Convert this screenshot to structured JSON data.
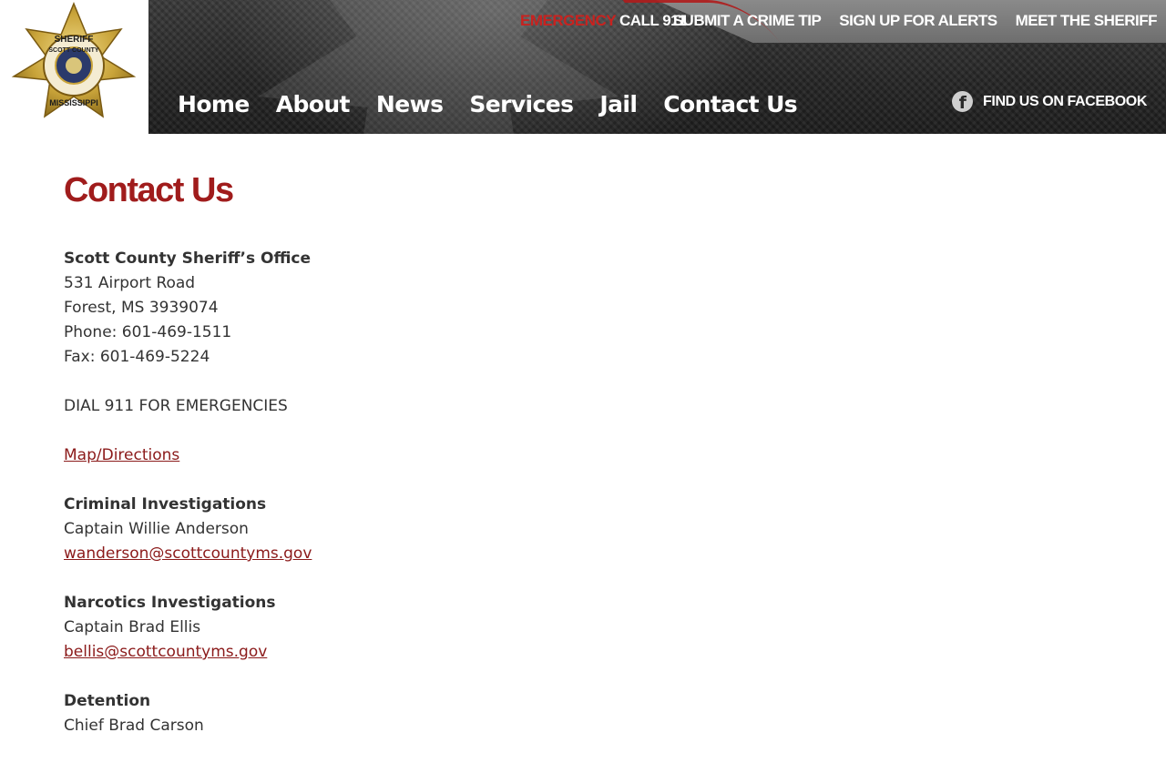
{
  "header": {
    "logo": {
      "seal_text_top": "SHERIFF",
      "seal_text_mid": "SCOTT COUNTY",
      "seal_text_bottom": "MISSISSIPPI"
    },
    "emergency": {
      "prefix": "EMERGENCY",
      "suffix": " CALL 911"
    },
    "top_links": [
      "SUBMIT A CRIME TIP",
      "SIGN UP FOR ALERTS",
      "MEET THE SHERIFF"
    ],
    "nav": [
      "Home",
      "About",
      "News",
      "Services",
      "Jail",
      "Contact Us"
    ],
    "facebook_label": "FIND US ON FACEBOOK"
  },
  "page": {
    "title": "Contact Us",
    "office": {
      "name": "Scott County Sheriff’s Office",
      "address1": "531 Airport Road",
      "address2": "Forest, MS 3939074",
      "phone": "Phone: 601-469-1511",
      "fax": "Fax: 601-469-5224"
    },
    "emergency_note": "DIAL 911 FOR EMERGENCIES",
    "map_link": "Map/Directions",
    "departments": [
      {
        "name": "Criminal Investigations",
        "contact": "Captain Willie Anderson",
        "email": "wanderson@scottcountyms.gov"
      },
      {
        "name": "Narcotics Investigations",
        "contact": "Captain Brad Ellis",
        "email": "bellis@scottcountyms.gov"
      },
      {
        "name": "Detention",
        "contact": "Chief Brad Carson"
      }
    ]
  },
  "colors": {
    "accent_red": "#a01c1c",
    "link_red": "#8b1a1a",
    "banner_dark": "#262626",
    "badge_gold": "#c9a43a"
  }
}
